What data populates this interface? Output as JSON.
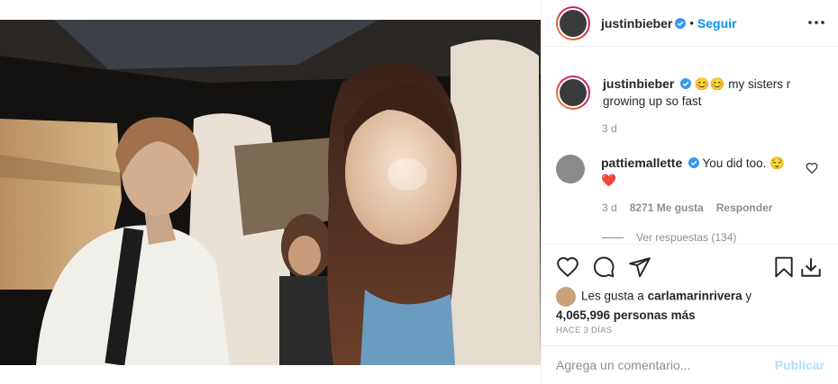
{
  "post": {
    "author": "justinbieber",
    "follow_label": "Seguir",
    "dot": "•"
  },
  "caption": {
    "username": "justinbieber",
    "text": "😊😊 my sisters r growing up so fast",
    "time": "3 d"
  },
  "comment": {
    "username": "pattiemallette",
    "text": "You did too. 😌",
    "heart": "❤️",
    "time": "3 d",
    "likes": "8271 Me gusta",
    "reply_label": "Responder",
    "view_replies": "Ver respuestas (134)"
  },
  "likes": {
    "prefix": "Les gusta a",
    "user": "carlamarinrivera",
    "connector": "y",
    "count": "4,065,996 personas más"
  },
  "timestamp": "HACE 3 DÍAS",
  "composer": {
    "placeholder": "Agrega un comentario...",
    "post_label": "Publicar"
  },
  "colors": {
    "accent": "#0095f6",
    "verified": "#3897f0",
    "heart": "#ed4956",
    "muted": "#8e8e8e"
  },
  "icons": [
    "more-options-icon",
    "heart-icon",
    "comment-icon",
    "share-icon",
    "save-icon",
    "download-icon",
    "verified-icon"
  ]
}
